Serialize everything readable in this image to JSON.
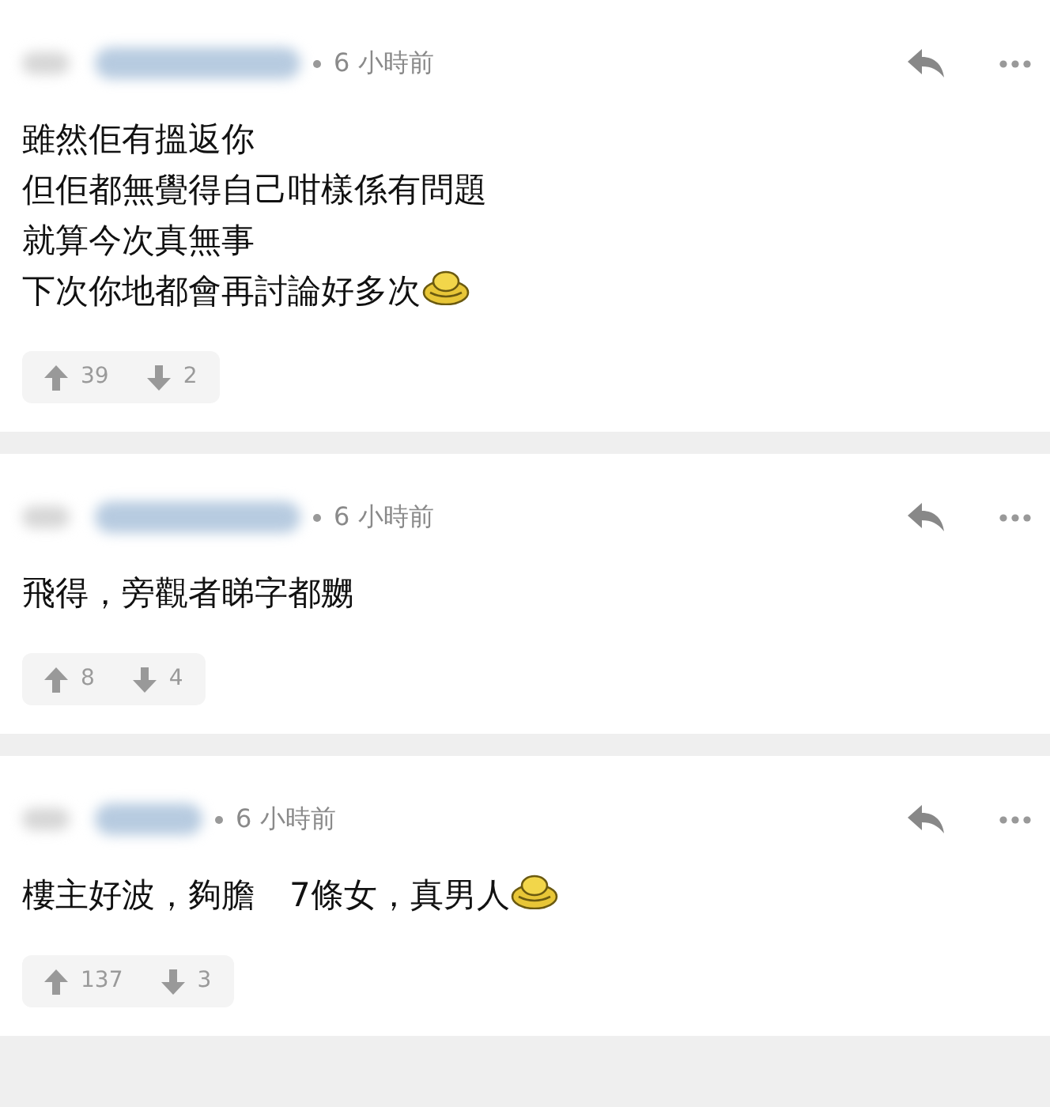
{
  "comments": [
    {
      "time": "6 小時前",
      "lines": [
        {
          "parts": [
            "雖然佢有搵返你"
          ]
        },
        {
          "parts": [
            "但佢都無覺得自己咁樣係有問題"
          ]
        },
        {
          "parts": [
            "就算今次真無事"
          ]
        },
        {
          "parts": [
            "下次你地都會再討論好多次"
          ],
          "emoticon": true
        }
      ],
      "upvotes": "39",
      "downvotes": "2"
    },
    {
      "time": "6 小時前",
      "lines": [
        {
          "parts": [
            "飛得，旁觀者睇字都嬲"
          ]
        }
      ],
      "upvotes": "8",
      "downvotes": "4"
    },
    {
      "time": "6 小時前",
      "lines": [
        {
          "parts": [
            "樓主好波，夠膽",
            "7條女，真男人"
          ],
          "emoticon": true
        }
      ],
      "upvotes": "137",
      "downvotes": "3"
    }
  ]
}
